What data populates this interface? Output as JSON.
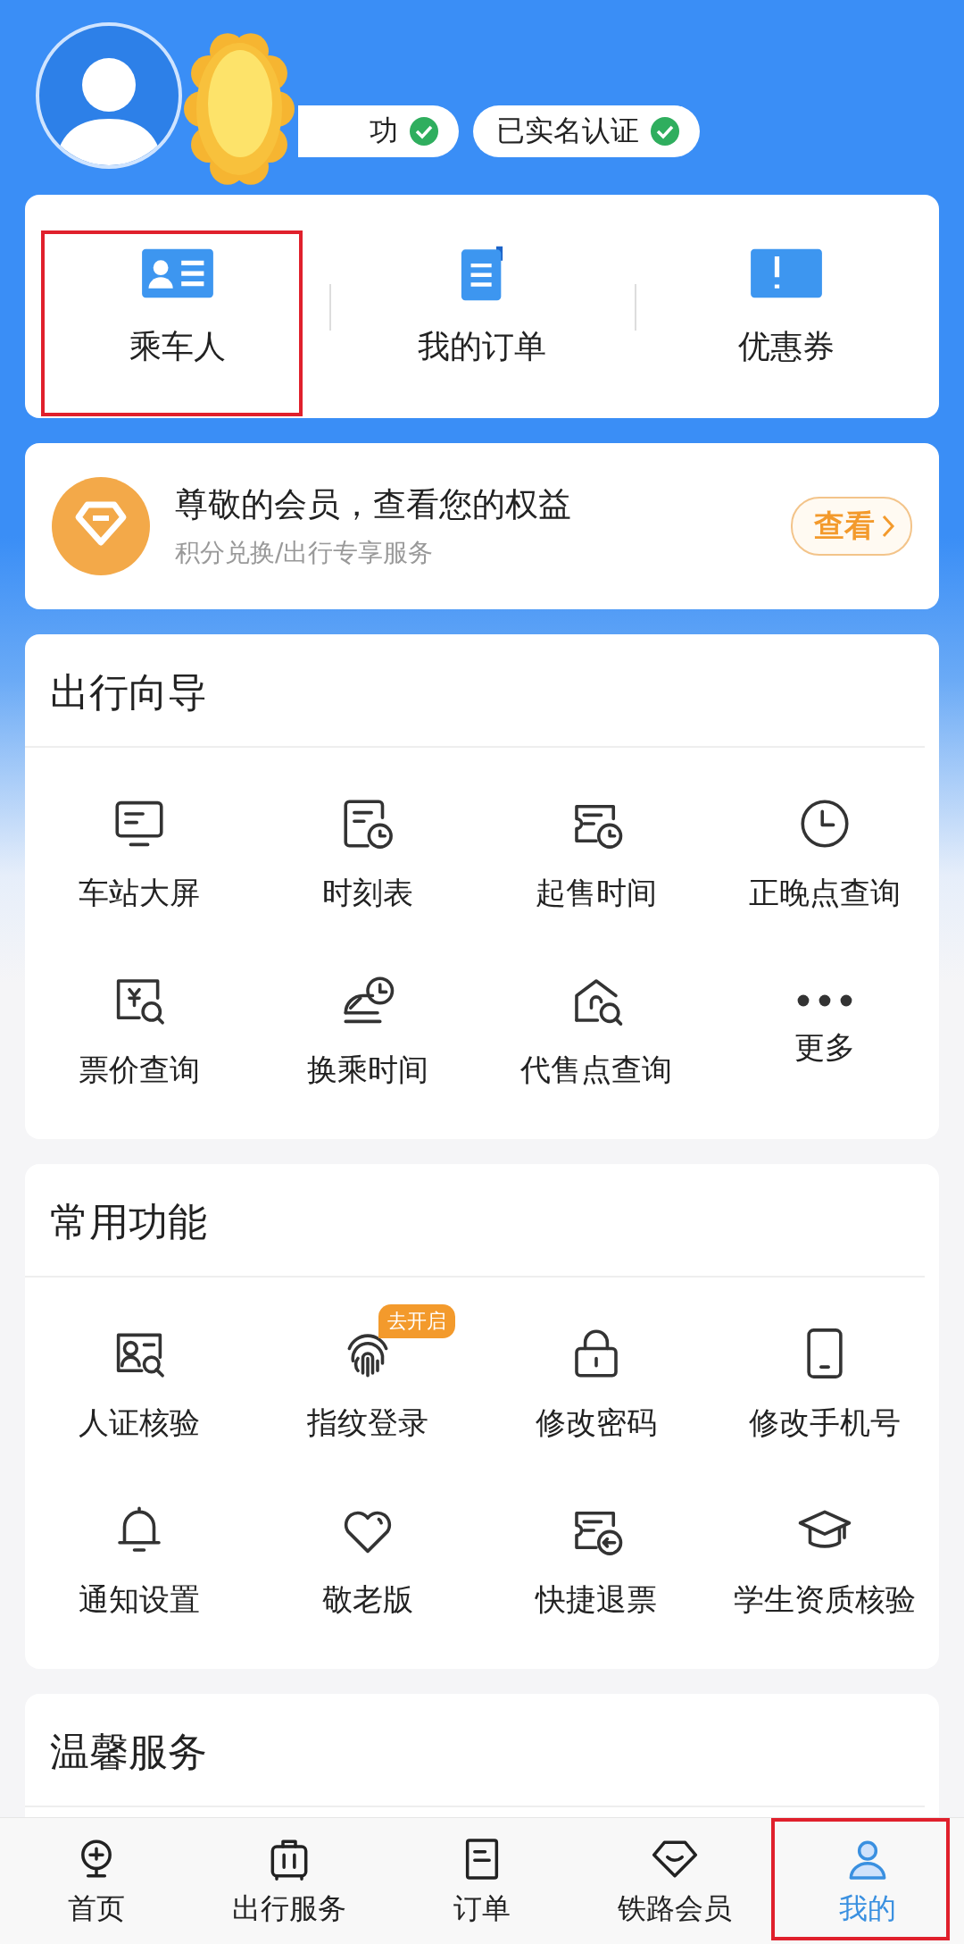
{
  "profile": {
    "badges": [
      {
        "label": "功",
        "verified": true
      },
      {
        "label": "已实名认证",
        "verified": true
      }
    ]
  },
  "sticker": {
    "kind": "sun"
  },
  "quick_links": [
    {
      "label": "乘车人",
      "highlighted": true
    },
    {
      "label": "我的订单",
      "highlighted": false
    },
    {
      "label": "优惠券",
      "highlighted": false
    }
  ],
  "member_card": {
    "title": "尊敬的会员，查看您的权益",
    "subtitle": "积分兑换/出行专享服务",
    "button": "查看"
  },
  "sections": [
    {
      "title": "出行向导",
      "items": [
        {
          "label": "车站大屏"
        },
        {
          "label": "时刻表"
        },
        {
          "label": "起售时间"
        },
        {
          "label": "正晚点查询"
        },
        {
          "label": "票价查询"
        },
        {
          "label": "换乘时间"
        },
        {
          "label": "代售点查询"
        },
        {
          "label": "更多"
        }
      ]
    },
    {
      "title": "常用功能",
      "items": [
        {
          "label": "人证核验"
        },
        {
          "label": "指纹登录",
          "badge": "去开启"
        },
        {
          "label": "修改密码"
        },
        {
          "label": "修改手机号"
        },
        {
          "label": "通知设置"
        },
        {
          "label": "敬老版"
        },
        {
          "label": "快捷退票"
        },
        {
          "label": "学生资质核验"
        }
      ]
    },
    {
      "title": "温馨服务"
    }
  ],
  "tabs": [
    {
      "label": "首页",
      "selected": false,
      "highlighted": false
    },
    {
      "label": "出行服务",
      "selected": false,
      "highlighted": false
    },
    {
      "label": "订单",
      "selected": false,
      "highlighted": false
    },
    {
      "label": "铁路会员",
      "selected": false,
      "highlighted": false
    },
    {
      "label": "我的",
      "selected": true,
      "highlighted": true
    }
  ]
}
